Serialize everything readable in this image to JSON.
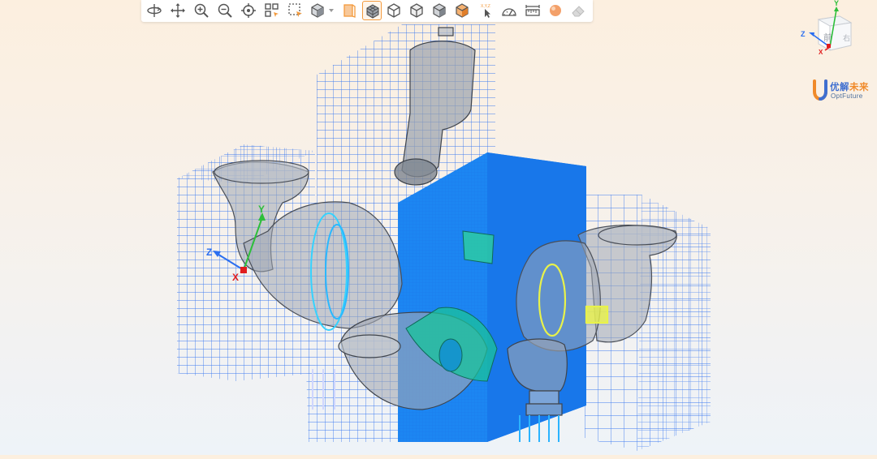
{
  "toolbar": {
    "tools": [
      {
        "id": "rotate",
        "icon": "rotate-icon"
      },
      {
        "id": "pan",
        "icon": "pan-icon"
      },
      {
        "id": "zoom-in",
        "icon": "zoom-in-icon"
      },
      {
        "id": "zoom-out",
        "icon": "zoom-out-icon"
      },
      {
        "id": "fit-view",
        "icon": "fit-view-icon"
      },
      {
        "id": "select-grid",
        "icon": "select-grid-icon"
      },
      {
        "id": "box-select",
        "icon": "box-select-icon"
      },
      {
        "id": "view-cube",
        "icon": "view-cube-icon"
      },
      {
        "id": "section-plane",
        "icon": "section-plane-icon"
      },
      {
        "id": "mesh-display",
        "icon": "mesh-display-icon",
        "active": true
      },
      {
        "id": "wireframe",
        "icon": "wireframe-icon"
      },
      {
        "id": "shaded-edges",
        "icon": "shaded-edges-icon"
      },
      {
        "id": "shaded",
        "icon": "shaded-icon"
      },
      {
        "id": "solid-orange",
        "icon": "solid-orange-icon"
      },
      {
        "id": "probe",
        "icon": "probe-cursor-icon"
      },
      {
        "id": "measure-angle",
        "icon": "angle-measure-icon"
      },
      {
        "id": "measure-distance",
        "icon": "ruler-icon"
      },
      {
        "id": "material",
        "icon": "sphere-icon"
      },
      {
        "id": "eraser",
        "icon": "eraser-icon"
      }
    ],
    "probe_label": "X,Y,Z"
  },
  "triad": {
    "x": "X",
    "y": "Y",
    "z": "Z"
  },
  "viewcube": {
    "x": "X",
    "y": "Y",
    "z": "Z",
    "front_face": "前",
    "right_face": "右"
  },
  "logo": {
    "cn_part1": "优解",
    "cn_part2": "未来",
    "en": "OptFuture"
  },
  "colors": {
    "mesh": "#1e6be6",
    "solid_block": "#2a8cf5",
    "accent": "#f39a3c",
    "logo_blue": "#3f6fd0",
    "logo_orange": "#f08a2a"
  }
}
